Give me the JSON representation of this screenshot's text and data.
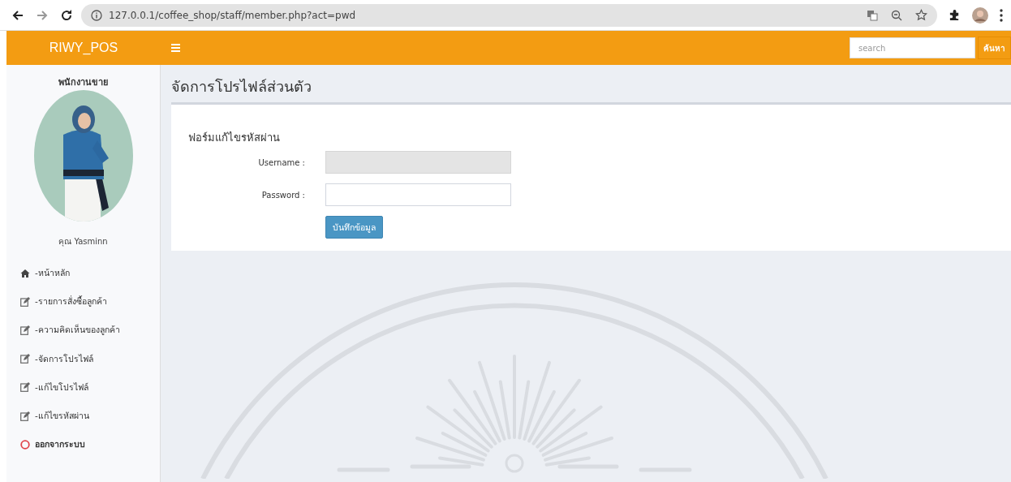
{
  "browser": {
    "nav_buttons": [
      {
        "kind": "back",
        "disabled": false
      },
      {
        "kind": "forward",
        "disabled": true
      },
      {
        "kind": "reload",
        "disabled": false
      }
    ],
    "url": "127.0.0.1/coffee_shop/staff/member.php?act=pwd"
  },
  "navbar": {
    "brand": "RIWY_POS",
    "search": {
      "placeholder": "search"
    },
    "search_button": "ค้นหา"
  },
  "sidebar": {
    "role": "พนักงานขาย",
    "user_name": "คุณ Yasminn",
    "items": [
      {
        "label": "-หน้าหลัก",
        "kind": "home"
      },
      {
        "label": "-รายการสั่งซื้อลูกค้า",
        "kind": "edit"
      },
      {
        "label": "-ความคิดเห็นของลูกค้า",
        "kind": "edit"
      },
      {
        "label": "-จัดการโปรไฟล์",
        "kind": "edit"
      },
      {
        "label": "-แก้ไขโปรไฟล์",
        "kind": "edit"
      },
      {
        "label": "-แก้ไขรหัสผ่าน",
        "kind": "edit"
      },
      {
        "label": "ออกจากระบบ",
        "kind": "logout"
      }
    ]
  },
  "main": {
    "title": "จัดการโปรไฟล์ส่วนตัว",
    "form": {
      "heading": "ฟอร์มแก้ไขรหัสผ่าน",
      "fields": [
        {
          "label": "Username :",
          "disabled": true
        },
        {
          "label": "Password :",
          "disabled": false
        }
      ],
      "submit": "บันทึกข้อมูล"
    }
  }
}
